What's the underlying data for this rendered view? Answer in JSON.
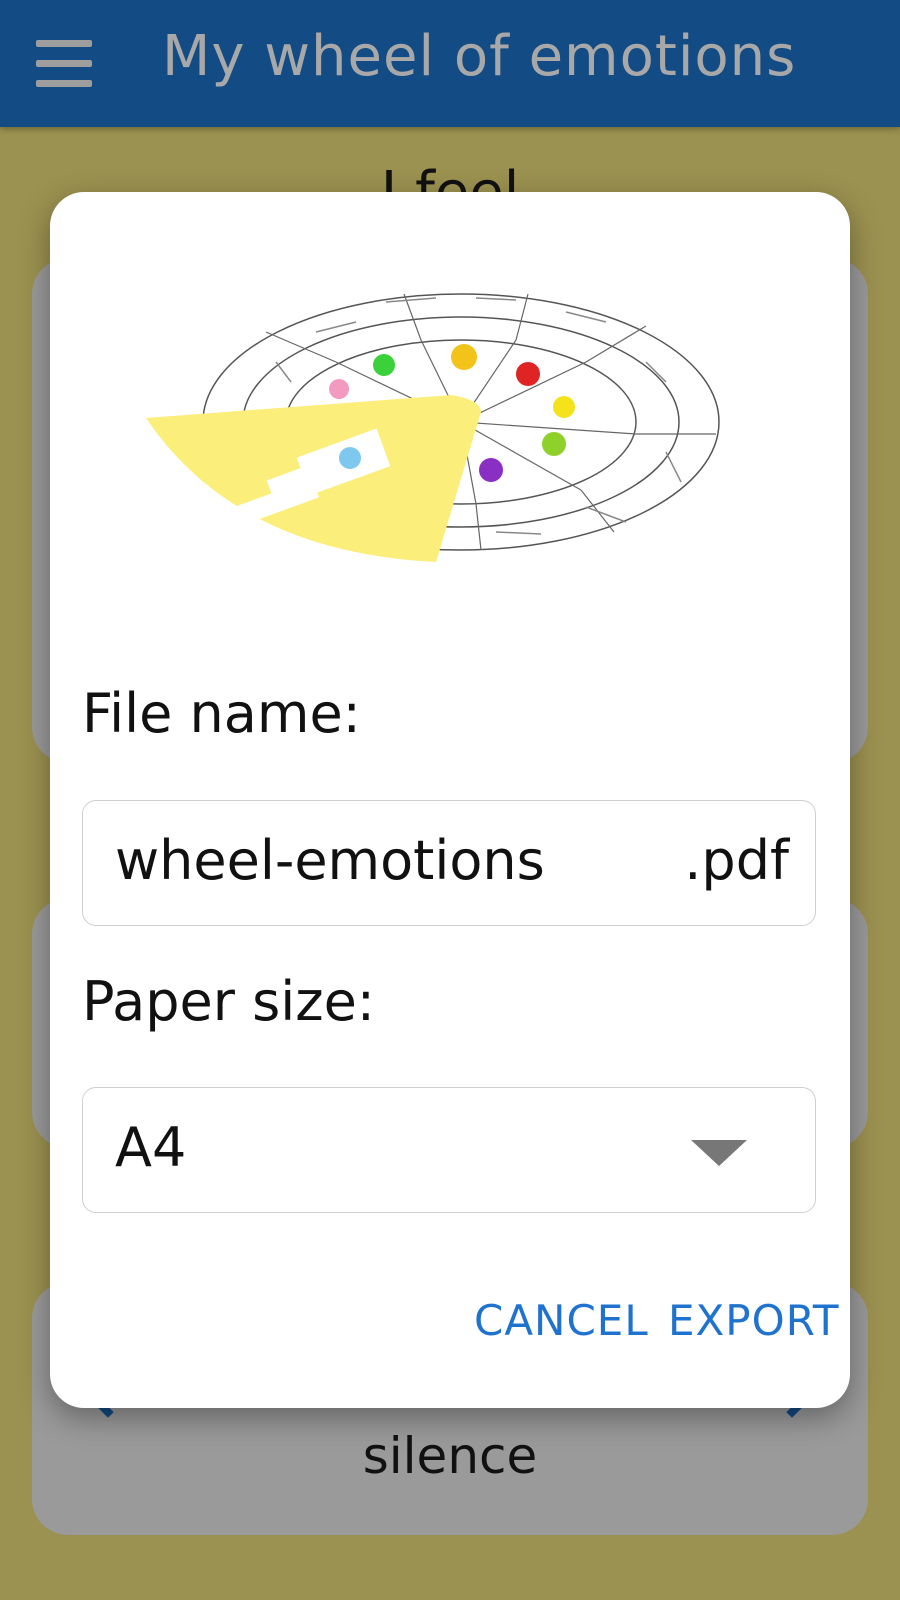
{
  "app": {
    "title": "My wheel of emotions",
    "menu_icon": "hamburger-menu-icon",
    "colors": {
      "appbar": "#134b84",
      "background": "#9b9150",
      "card": "#9a9a9a",
      "accent": "#1f73cf"
    }
  },
  "background": {
    "heading": "I feel",
    "card_text": "silence"
  },
  "dialog": {
    "preview_image": "emotion-wheel-preview",
    "file_label": "File name:",
    "file_value": "wheel-emotions",
    "file_suffix": ".pdf",
    "paper_label": "Paper size:",
    "paper_value": "A4",
    "paper_options": [
      "A4"
    ],
    "cancel_label": "CANCEL",
    "export_label": "EXPORT"
  }
}
